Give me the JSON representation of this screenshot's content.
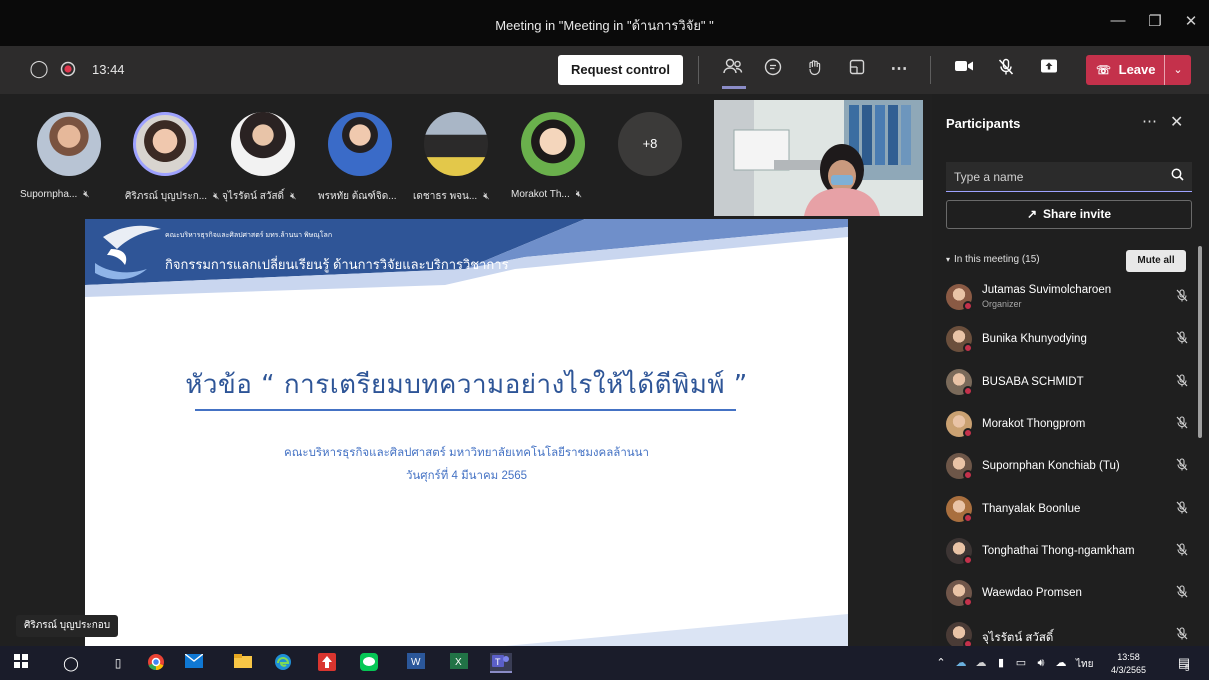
{
  "window": {
    "title": "Meeting in \"Meeting in \"ด้านการวิจัย\" \""
  },
  "toolbar": {
    "timer": "13:44",
    "request_control_label": "Request control",
    "leave_label": "Leave"
  },
  "stage": {
    "overflow_count": "+8",
    "participants": [
      {
        "name": "Supornpha..."
      },
      {
        "name": "ศิริภรณ์ บุญประก..."
      },
      {
        "name": "จุไรรัตน์ สวัสดิ์"
      },
      {
        "name": "พรหทัย ต้ณฑ์จิด..."
      },
      {
        "name": "เดชาธร พจน..."
      },
      {
        "name": "Morakot Th..."
      }
    ],
    "speaker_name": "ศิริภรณ์ บุญประกอบ"
  },
  "slide": {
    "header_small": "คณะบริหารธุรกิจและศิลปศาสตร์ มทร.ล้านนา พิษณุโลก",
    "header": "กิจกรรมการแลกเปลี่ยนเรียนรู้ ด้านการวิจัยและบริการวิชาการ",
    "title": "หัวข้อ “ การเตรียมบทความอย่างไรให้ได้ตีพิมพ์ ”",
    "subtitle_1": "คณะบริหารธุรกิจและศิลปศาสตร์ มหาวิทยาลัยเทคโนโลยีราชมงคลล้านนา",
    "subtitle_2": "วันศุกร์ที่ 4 มีนาคม 2565"
  },
  "panel": {
    "title": "Participants",
    "search_placeholder": "Type a name",
    "share_label": "Share invite",
    "section_label": "In this meeting (15)",
    "mute_all_label": "Mute all",
    "people": [
      {
        "name": "Jutamas Suvimolcharoen",
        "role": "Organizer",
        "color": "#8a5a44"
      },
      {
        "name": "Bunika Khunyodying",
        "role": "",
        "color": "#6b4f3c"
      },
      {
        "name": "BUSABA SCHMIDT",
        "role": "",
        "color": "#7a6a5a"
      },
      {
        "name": "Morakot Thongprom",
        "role": "",
        "color": "#caa172"
      },
      {
        "name": "Supornphan Konchiab (Tu)",
        "role": "",
        "color": "#6d5648"
      },
      {
        "name": "Thanyalak Boonlue",
        "role": "",
        "color": "#a96f3e"
      },
      {
        "name": "Tonghathai Thong-ngamkham",
        "role": "",
        "color": "#3d3534"
      },
      {
        "name": "Waewdao Promsen",
        "role": "",
        "color": "#70564a"
      },
      {
        "name": "จุไรรัตน์ สวัสดิ์",
        "role": "",
        "color": "#4a3b36"
      }
    ]
  },
  "taskbar": {
    "lang": "ไทย",
    "time": "13:58",
    "date": "4/3/2565",
    "notif_count": "5"
  }
}
